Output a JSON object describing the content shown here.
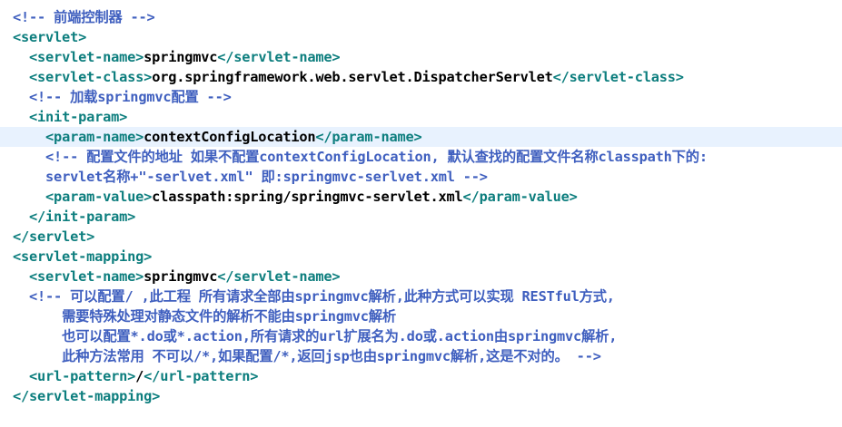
{
  "colors": {
    "tag": "#0d7e7e",
    "comment": "#3f5fbf",
    "text": "#000000",
    "current_line": "#e8f2fe"
  },
  "lines": [
    {
      "indent": "",
      "kind": "comment",
      "text": "<!-- 前端控制器 -->"
    },
    {
      "indent": "",
      "kind": "tag",
      "open": "<servlet>",
      "value": "",
      "close": ""
    },
    {
      "indent": "  ",
      "kind": "tag",
      "open": "<servlet-name>",
      "value": "springmvc",
      "close": "</servlet-name>"
    },
    {
      "indent": "  ",
      "kind": "tag",
      "open": "<servlet-class>",
      "value": "org.springframework.web.servlet.DispatcherServlet",
      "close": "</servlet-class>"
    },
    {
      "indent": "  ",
      "kind": "comment",
      "text": "<!-- 加载springmvc配置 -->"
    },
    {
      "indent": "  ",
      "kind": "tag",
      "open": "<init-param>",
      "value": "",
      "close": ""
    },
    {
      "indent": "    ",
      "kind": "tag",
      "open": "<param-name>",
      "value": "contextConfigLocation",
      "close": "</param-name>",
      "current": true
    },
    {
      "indent": "    ",
      "kind": "comment",
      "text": "<!-- 配置文件的地址 如果不配置contextConfigLocation, 默认查找的配置文件名称classpath下的:"
    },
    {
      "indent": "    ",
      "kind": "comment",
      "text": "servlet名称+\"-serlvet.xml\" 即:springmvc-serlvet.xml -->"
    },
    {
      "indent": "    ",
      "kind": "tag",
      "open": "<param-value>",
      "value": "classpath:spring/springmvc-servlet.xml",
      "close": "</param-value>"
    },
    {
      "indent": "  ",
      "kind": "tag",
      "open": "</init-param>",
      "value": "",
      "close": ""
    },
    {
      "indent": "",
      "kind": "tag",
      "open": "</servlet>",
      "value": "",
      "close": ""
    },
    {
      "indent": "",
      "kind": "tag",
      "open": "<servlet-mapping>",
      "value": "",
      "close": ""
    },
    {
      "indent": "  ",
      "kind": "tag",
      "open": "<servlet-name>",
      "value": "springmvc",
      "close": "</servlet-name>"
    },
    {
      "indent": "  ",
      "kind": "comment",
      "text": "<!-- 可以配置/ ,此工程 所有请求全部由springmvc解析,此种方式可以实现 RESTful方式,"
    },
    {
      "indent": "      ",
      "kind": "comment",
      "text": "需要特殊处理对静态文件的解析不能由springmvc解析"
    },
    {
      "indent": "      ",
      "kind": "comment",
      "text": "也可以配置*.do或*.action,所有请求的url扩展名为.do或.action由springmvc解析,"
    },
    {
      "indent": "      ",
      "kind": "comment",
      "text": "此种方法常用 不可以/*,如果配置/*,返回jsp也由springmvc解析,这是不对的。 -->"
    },
    {
      "indent": "  ",
      "kind": "tag",
      "open": "<url-pattern>",
      "value": "/",
      "close": "</url-pattern>"
    },
    {
      "indent": "",
      "kind": "tag",
      "open": "</servlet-mapping>",
      "value": "",
      "close": ""
    }
  ]
}
